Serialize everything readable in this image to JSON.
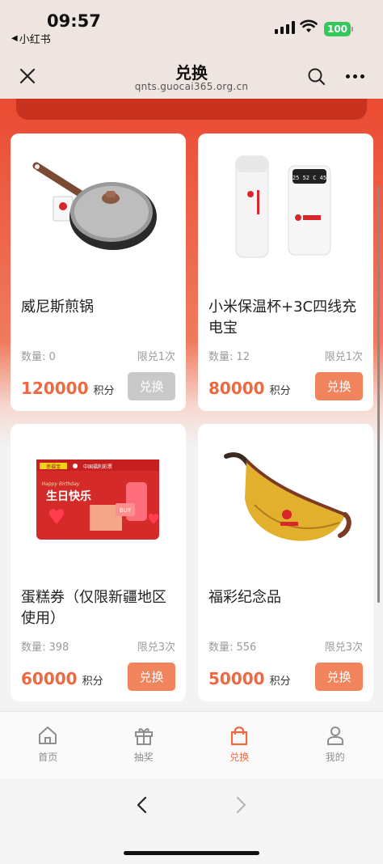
{
  "status": {
    "time": "09:57",
    "back_app": "小红书",
    "battery": "100"
  },
  "header": {
    "title": "兑换",
    "domain": "qnts.guocai365.org.cn"
  },
  "products": [
    {
      "name": "威尼斯煎锅",
      "qty": "数量: 0",
      "limit": "限兑1次",
      "points": "120000",
      "unit": "积分",
      "button": "兑换",
      "enabled": false,
      "image": "frying-pan"
    },
    {
      "name": "小米保温杯+3C四线充电宝",
      "qty": "数量: 12",
      "limit": "限兑1次",
      "points": "80000",
      "unit": "积分",
      "button": "兑换",
      "enabled": true,
      "image": "thermos-and-power-bank"
    },
    {
      "name": "蛋糕券（仅限新疆地区使用）",
      "qty": "数量: 398",
      "limit": "限兑3次",
      "points": "60000",
      "unit": "积分",
      "button": "兑换",
      "enabled": true,
      "image": "cake-voucher-card"
    },
    {
      "name": "福彩纪念品",
      "qty": "数量: 556",
      "limit": "限兑3次",
      "points": "50000",
      "unit": "积分",
      "button": "兑换",
      "enabled": true,
      "image": "waist-bag"
    }
  ],
  "card_texts": {
    "lottery_logo": "中国福利彩票",
    "brand_left": "幸福宝",
    "happy": "Happy Birthday",
    "birthday": "生日快乐",
    "buy": "BUY",
    "pb_time": "25 52 C 45"
  },
  "tabs": [
    {
      "label": "首页",
      "icon": "home-icon"
    },
    {
      "label": "抽奖",
      "icon": "gift-icon"
    },
    {
      "label": "兑换",
      "icon": "shopping-bag-icon",
      "active": true
    },
    {
      "label": "我的",
      "icon": "user-icon"
    }
  ],
  "colors": {
    "accent": "#ef6b3f",
    "button_active": "#f2845d",
    "button_disabled": "#c9c9c9",
    "price": "#f0683f",
    "header_bg": "#efe5e0"
  }
}
